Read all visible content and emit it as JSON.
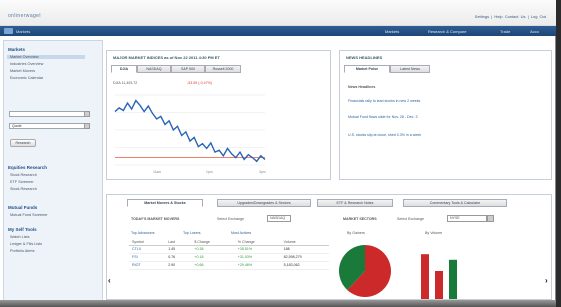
{
  "header": {
    "logo_text": "onlinerwagel",
    "links": "Settings | Help Contact Us | Log Out"
  },
  "nav": {
    "title": "Markets",
    "items": [
      "Markets",
      "Research & Compare",
      "Trade",
      "Acco"
    ]
  },
  "sidebar": {
    "section1": "Markets",
    "links1": [
      "Market Overview",
      "Industries Overview",
      "Market Movers",
      "Economic Calendar"
    ],
    "quote_placeholder": "",
    "select_value": "Quote",
    "button": "Research",
    "section2": "Equities Research",
    "links2": [
      "Stock Research",
      "ETF Screener",
      "Stock Research"
    ],
    "section3": "Mutual Funds",
    "links3": [
      "Mutual Fund Screener"
    ],
    "section4": "My Self Tools",
    "links4": [
      "Watch Lists",
      "Ledger & Fills Lists",
      "Portfolio Alerts"
    ]
  },
  "markets": {
    "title": "MAJOR MARKET INDICES  as of Nov 22 2011 4:30 PM ET",
    "tabs": [
      "DJIA",
      "NASDAQ",
      "S&P 500",
      "Russell 2000"
    ],
    "stat_label": "DJIA 11,493.72",
    "stat_change": "-53.59 (-0.47%)"
  },
  "news": {
    "title": "NEWS HEADLINES",
    "tabs": [
      "Market Pulse",
      "Latest News"
    ],
    "subhead": "News Headlines",
    "items": [
      "Financials rally to lead stocks in new 2 weeks",
      "Mutual Fund flows slide for Nov. 28 - Dec. 3",
      "U.S. stocks slip at close, shed 0.3% in a week"
    ]
  },
  "bottom": {
    "tabs": [
      "Market Movers & Stocks",
      "Upgrades/Downgrades & Sectors",
      "ETF & Research Notes",
      "Commentary Tools & Calculator"
    ],
    "movers_title": "TODAY'S MARKET MOVERS",
    "movers_filter": "Select Exchange",
    "movers_select": "NASDAQ",
    "movers_links": [
      "Top Advancers",
      "Top Losers",
      "Most Actives"
    ],
    "columns": [
      "Symbol",
      "Last",
      "$ Change",
      "% Change",
      "Volume"
    ],
    "rows": [
      [
        "CTLX",
        "1.45",
        "+0.38",
        "+35.51%",
        "188"
      ],
      [
        "FSI",
        "0.76",
        "+0.18",
        "+31.03%",
        "82,598,279"
      ],
      [
        "RIOT",
        "2.90",
        "+0.66",
        "+29.46%",
        "5,183,062"
      ]
    ],
    "sectors_title": "MARKET SECTORS",
    "sectors_filter": "Select Exchange",
    "sectors_select": "NYSE",
    "pie_label": "By Gainers",
    "bar_label": "By Volume"
  },
  "chart_data": [
    {
      "type": "line",
      "title": "",
      "series": [
        {
          "name": "",
          "values": [
            11950,
            12050,
            11980,
            12180,
            12020,
            12250,
            12120,
            11950,
            12100,
            11900,
            11750,
            11820,
            11600,
            11700,
            11450,
            11550,
            11300,
            11400,
            11150,
            11250,
            11000,
            11080,
            10950,
            11100,
            10850,
            10900,
            10750,
            10950,
            10800,
            10700,
            10850,
            10650,
            10780,
            10700,
            10600,
            10750,
            10650
          ]
        }
      ],
      "reference_line": 10700,
      "colors": {
        "line": "#2a64b8",
        "ref": "#e05a3a"
      }
    },
    {
      "type": "pie",
      "values": [
        0.62,
        0.38
      ],
      "colors": [
        "#cc2a2a",
        "#1a7a3a"
      ]
    },
    {
      "type": "bar",
      "values": [
        0.8,
        0.5,
        0.7
      ],
      "colors": [
        "#cc2a2a",
        "#cc2a2a",
        "#1a7a3a"
      ]
    }
  ]
}
